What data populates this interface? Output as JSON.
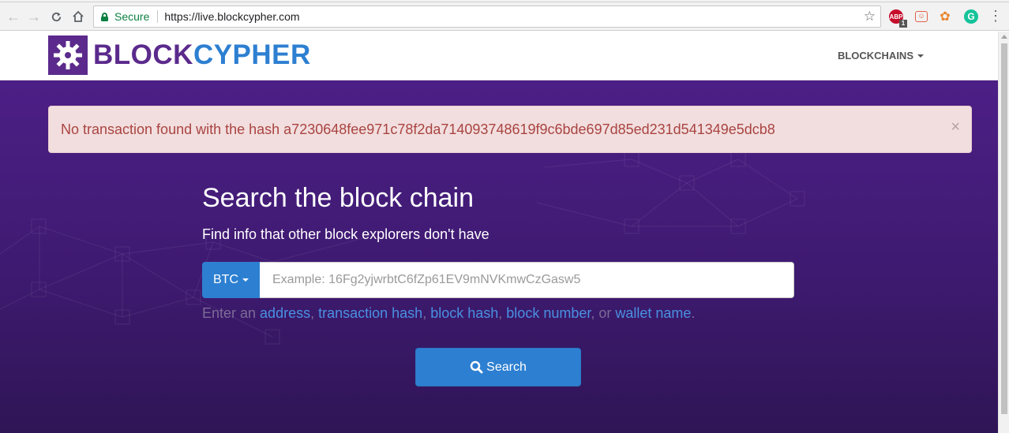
{
  "browser": {
    "secure_label": "Secure",
    "url": "https://live.blockcypher.com",
    "abp_label": "ABP",
    "abp_badge": "1",
    "grammarly_label": "G"
  },
  "navbar": {
    "logo_part1": "BLOCK",
    "logo_part2": "CYPHER",
    "blockchains_label": "BLOCKCHAINS"
  },
  "alert": {
    "message": "No transaction found with the hash a7230648fee971c78f2da714093748619f9c6bde697d85ed231d541349e5dcb8",
    "close": "×"
  },
  "hero": {
    "title": "Search the block chain",
    "subtitle": "Find info that other block explorers don't have"
  },
  "search": {
    "coin_label": "BTC",
    "placeholder": "Example: 16Fg2yjwrbtC6fZp61EV9mNVKmwCzGasw5",
    "button_label": "Search"
  },
  "hint": {
    "prefix": "Enter an ",
    "address": "address",
    "sep1": ", ",
    "transaction_hash": "transaction hash",
    "sep2": ", ",
    "block_hash": "block hash",
    "sep3": ", ",
    "block_number": "block number",
    "sep4": ", or ",
    "wallet_name": "wallet name",
    "suffix": "."
  },
  "colors": {
    "brand_purple": "#5b2a8c",
    "brand_blue": "#2d7fd1",
    "alert_bg": "#f2dede",
    "alert_text": "#a94442"
  }
}
